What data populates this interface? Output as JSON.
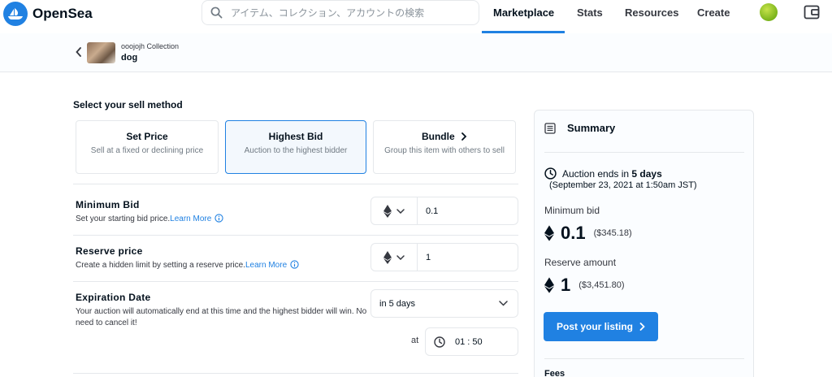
{
  "brand": {
    "name": "OpenSea",
    "color": "#2081e2"
  },
  "search": {
    "placeholder": "アイテム、コレクション、アカウントの検索"
  },
  "nav": {
    "items": [
      {
        "label": "Marketplace",
        "active": true
      },
      {
        "label": "Stats"
      },
      {
        "label": "Resources"
      },
      {
        "label": "Create"
      }
    ]
  },
  "breadcrumb": {
    "collection": "ooojojh Collection",
    "item": "dog"
  },
  "sell": {
    "title": "Select your sell method",
    "methods": [
      {
        "title": "Set Price",
        "desc": "Sell at a fixed or declining price"
      },
      {
        "title": "Highest Bid",
        "desc": "Auction to the highest bidder",
        "selected": true
      },
      {
        "title": "Bundle",
        "desc": "Group this item with others to sell"
      }
    ]
  },
  "minimum_bid": {
    "title": "Minimum Bid",
    "desc": "Set your starting bid price.",
    "learn": "Learn More",
    "value": "0.1"
  },
  "reserve": {
    "title": "Reserve price",
    "desc": "Create a hidden limit by setting a reserve price.",
    "learn": "Learn More",
    "value": "1"
  },
  "expiration": {
    "title": "Expiration Date",
    "desc": "Your auction will automatically end at this time and the highest bidder will win. No need to cancel it!",
    "duration": "in 5 days",
    "at_label": "at",
    "time": "01 : 50"
  },
  "summary": {
    "title": "Summary",
    "ends_prefix": "Auction ends in",
    "ends_bold": "5 days",
    "ends_date": "(September 23, 2021 at 1:50am JST)",
    "min_bid_label": "Minimum bid",
    "min_bid_value": "0.1",
    "min_bid_usd": "($345.18)",
    "reserve_label": "Reserve amount",
    "reserve_value": "1",
    "reserve_usd": "($3,451.80)",
    "post_button": "Post your listing",
    "fees_label": "Fees"
  }
}
